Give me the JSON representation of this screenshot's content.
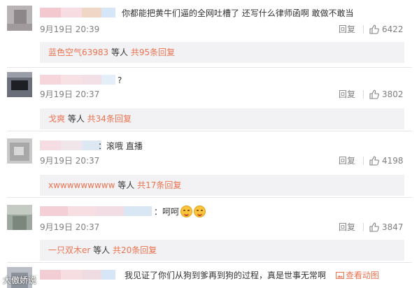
{
  "comments": [
    {
      "text": "你都能把黄牛们逼的全网吐槽了  还写什么律师函啊 敢做不敢当",
      "time": "9月19日 20:39",
      "reply_label": "回复",
      "likes": "6422",
      "thread": {
        "user": "蓝色空气63983",
        "suffix": " 等人",
        "count_text": "共95条回复"
      }
    },
    {
      "text": "?",
      "time": "9月19日 20:37",
      "reply_label": "回复",
      "likes": "3802",
      "thread": {
        "user": "戈爽",
        "suffix": " 等人",
        "count_text": "共34条回复"
      }
    },
    {
      "text": "：滚哦 直播",
      "time": "9月19日 20:37",
      "reply_label": "回复",
      "likes": "4198",
      "thread": {
        "user": "xwwwwwwwww",
        "suffix": " 等人",
        "count_text": "共17条回复"
      }
    },
    {
      "text": "：呵呵",
      "time": "9月19日 20:37",
      "reply_label": "回复",
      "likes": "3847",
      "thread": {
        "user": "一只双木er",
        "suffix": " 等人",
        "count_text": "共20条回复"
      }
    },
    {
      "text": "我见证了你们从狗到爹再到狗的过程，真是世事无常啊",
      "anim_label": "查看动图"
    }
  ],
  "emoji_icon": "laughing-emoji-icon",
  "like_icon": "thumbs-up-icon",
  "watermark_text": "大傲娇说",
  "colors": {
    "accent": "#eb7350",
    "meta": "#808080",
    "thread_bg": "#f2f2f5"
  }
}
